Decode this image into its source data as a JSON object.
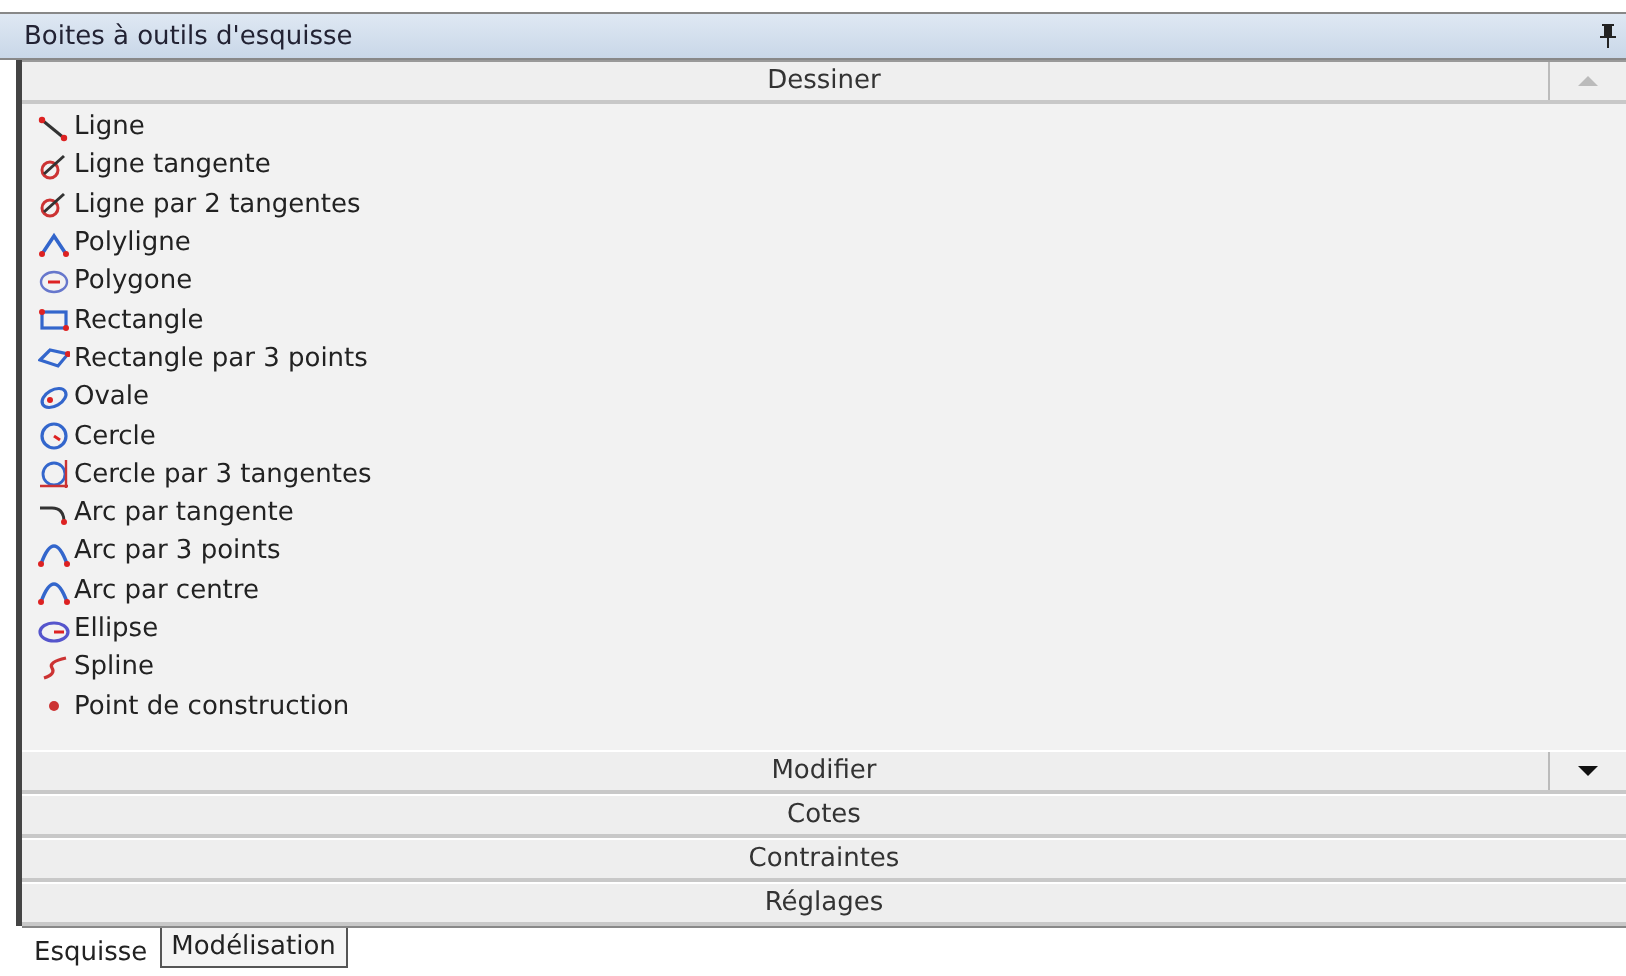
{
  "window": {
    "title": "Boites à outils d'esquisse"
  },
  "sections": [
    {
      "label": "Dessiner",
      "expanded": true,
      "scroll_button": {
        "kind": "up",
        "disabled": true
      },
      "items": [
        {
          "label": "Ligne",
          "kind": "line"
        },
        {
          "label": "Ligne tangente",
          "kind": "tangent"
        },
        {
          "label": "Ligne par 2 tangentes",
          "kind": "tangent"
        },
        {
          "label": "Polyligne",
          "kind": "polyline"
        },
        {
          "label": "Polygone",
          "kind": "polygon"
        },
        {
          "label": "Rectangle",
          "kind": "rect"
        },
        {
          "label": "Rectangle par 3 points",
          "kind": "rect3"
        },
        {
          "label": "Ovale",
          "kind": "oval"
        },
        {
          "label": "Cercle",
          "kind": "circle"
        },
        {
          "label": "Cercle par 3 tangentes",
          "kind": "circle3"
        },
        {
          "label": "Arc par tangente",
          "kind": "arctan"
        },
        {
          "label": "Arc par 3 points",
          "kind": "arc"
        },
        {
          "label": "Arc par centre",
          "kind": "arc"
        },
        {
          "label": "Ellipse",
          "kind": "ellipse"
        },
        {
          "label": "Spline",
          "kind": "spline"
        },
        {
          "label": "Point de construction",
          "kind": "point"
        }
      ]
    },
    {
      "label": "Modifier",
      "expanded": false,
      "scroll_button": {
        "kind": "down",
        "disabled": false
      }
    },
    {
      "label": "Cotes",
      "expanded": false
    },
    {
      "label": "Contraintes",
      "expanded": false
    },
    {
      "label": "Réglages",
      "expanded": false
    }
  ],
  "tabs": [
    {
      "label": "Esquisse",
      "selected": true
    },
    {
      "label": "Modélisation",
      "selected": false
    }
  ]
}
